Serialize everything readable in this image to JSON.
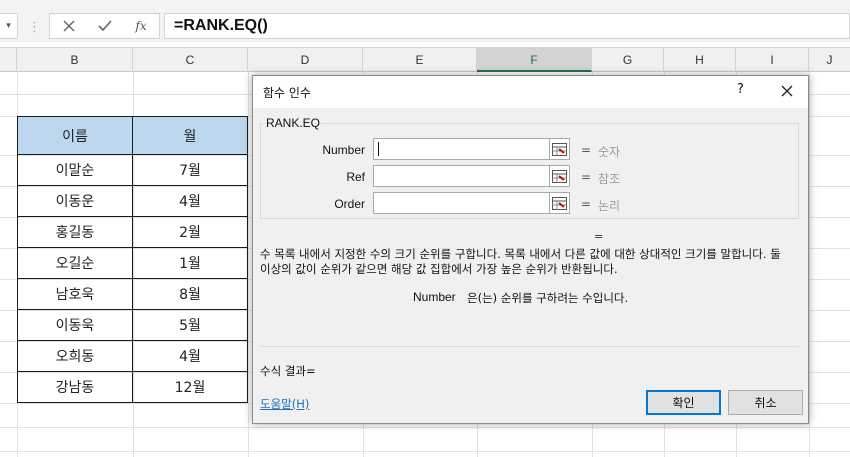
{
  "formula_bar": {
    "dropdown_glyph": "▾",
    "separator": "⋮",
    "cancel_glyph": "✕",
    "enter_glyph": "✓",
    "fx_glyph": "fx",
    "formula": "=RANK.EQ()"
  },
  "columns": [
    "B",
    "C",
    "D",
    "E",
    "F",
    "G",
    "H",
    "I",
    "J"
  ],
  "active_column": "F",
  "table": {
    "headers": [
      "이름",
      "월"
    ],
    "rows": [
      [
        "이말순",
        "7월"
      ],
      [
        "이동운",
        "4월"
      ],
      [
        "홍길동",
        "2월"
      ],
      [
        "오길순",
        "1월"
      ],
      [
        "남호욱",
        "8월"
      ],
      [
        "이동욱",
        "5월"
      ],
      [
        "오희동",
        "4월"
      ],
      [
        "강남동",
        "12월"
      ]
    ]
  },
  "dialog": {
    "title": "함수 인수",
    "help": "?",
    "function_name": "RANK.EQ",
    "args": [
      {
        "label": "Number",
        "hint": "숫자"
      },
      {
        "label": "Ref",
        "hint": "참조"
      },
      {
        "label": "Order",
        "hint": "논리"
      }
    ],
    "equals": "=",
    "description": "수 목록 내에서 지정한 수의 크기 순위를 구합니다. 목록 내에서 다른 값에 대한 상대적인 크기를 말합니다. 둘 이상의 값이 순위가 같으면 해당 값 집합에서 가장 높은 순위가 반환됩니다.",
    "arg_desc_name": "Number",
    "arg_desc_text": "은(는) 순위를 구하려는 수입니다.",
    "formula_result": "수식 결과=",
    "help_link": "도움말(H)",
    "ok": "확인",
    "cancel": "취소"
  },
  "colors": {
    "header_fill": "#bdd7ee",
    "active_column": "#217346",
    "link": "#1e6fbf",
    "focus": "#0078d7"
  }
}
